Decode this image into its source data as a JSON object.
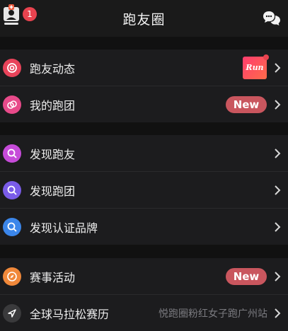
{
  "header": {
    "title": "跑友圈",
    "notification_count": "1"
  },
  "sections": [
    {
      "items": [
        {
          "label": "跑友动态",
          "icon": "target-icon",
          "color": "#e8435a",
          "trailing": "run-badge",
          "badge_text": "Run"
        },
        {
          "label": "我的跑团",
          "icon": "rings-icon",
          "color": "#e84a8a",
          "trailing": "new-badge",
          "badge_text": "New"
        }
      ]
    },
    {
      "items": [
        {
          "label": "发现跑友",
          "icon": "search-icon",
          "color": "#c64bd9"
        },
        {
          "label": "发现跑团",
          "icon": "search-icon",
          "color": "#7a5ce8"
        },
        {
          "label": "发现认证品牌",
          "icon": "search-icon",
          "color": "#3b86ea"
        }
      ]
    },
    {
      "items": [
        {
          "label": "赛事活动",
          "icon": "compass-icon",
          "color": "#f0883a",
          "trailing": "new-badge",
          "badge_text": "New"
        },
        {
          "label": "全球马拉松赛历",
          "icon": "navigation-arrow-icon",
          "color": "#3a3a3c",
          "subtext": "悦跑圈粉红女子跑广州站"
        }
      ]
    }
  ],
  "colors": {
    "background": "#111111",
    "row": "#1c1c1e",
    "new_badge": "#c9565e"
  }
}
